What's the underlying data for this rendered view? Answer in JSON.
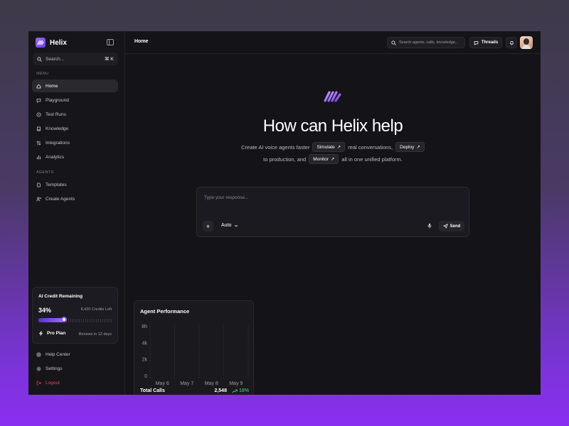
{
  "app": {
    "name": "Helix"
  },
  "sidebar": {
    "search_label": "Search...",
    "search_shortcut": "⌘ K",
    "menu_label": "MENU",
    "menu_items": [
      {
        "label": "Home",
        "icon": "home-icon",
        "active": true
      },
      {
        "label": "Playground",
        "icon": "chat-icon"
      },
      {
        "label": "Test Runs",
        "icon": "play-circle-icon"
      },
      {
        "label": "Knowledge",
        "icon": "book-icon"
      },
      {
        "label": "Integrations",
        "icon": "arrows-icon"
      },
      {
        "label": "Analytics",
        "icon": "bar-chart-icon"
      }
    ],
    "agents_label": "AGENTS",
    "agent_items": [
      {
        "label": "Templates",
        "icon": "file-icon"
      },
      {
        "label": "Create Agents",
        "icon": "user-plus-icon"
      }
    ],
    "credits": {
      "title": "AI Credit Remaining",
      "percent_label": "34%",
      "percent": 34,
      "credits_left": "8,420 Credits Left",
      "plan": "Pro Plan",
      "renews": "Renews in 12 days"
    },
    "footer_items": [
      {
        "label": "Help Center",
        "icon": "help-icon"
      },
      {
        "label": "Settings",
        "icon": "gear-icon"
      },
      {
        "label": "Logout",
        "icon": "logout-icon"
      }
    ]
  },
  "topbar": {
    "breadcrumb": "Home",
    "search_placeholder": "Search agents, calls, knowledge...",
    "threads_label": "Threads"
  },
  "hero": {
    "title": "How can Helix help",
    "line1_a": "Create AI voice agents faster",
    "chip_simulate": "Simulate",
    "line1_b": "real conversations,",
    "chip_deploy": "Deploy",
    "line2_a": "to production, and",
    "chip_monitor": "Monitor",
    "line2_b": "all in one unified platform."
  },
  "composer": {
    "placeholder": "Type your response...",
    "mode": "Auto",
    "send_label": "Send"
  },
  "performance": {
    "title": "Agent Performance",
    "total_label": "Total Calls",
    "total_value": "2,548",
    "change": "18%"
  },
  "chart_data": {
    "type": "bar",
    "title": "Agent Performance",
    "categories": [
      "May 6",
      "May 7",
      "May 8",
      "May 9"
    ],
    "y_ticks": [
      "8h",
      "4k",
      "2k",
      "0"
    ],
    "values": [
      0,
      0,
      0,
      0
    ],
    "grid": "vertical-dashed"
  },
  "colors": {
    "accent": "#8e5cff",
    "positive": "#4ade80",
    "danger": "#e2475b"
  }
}
